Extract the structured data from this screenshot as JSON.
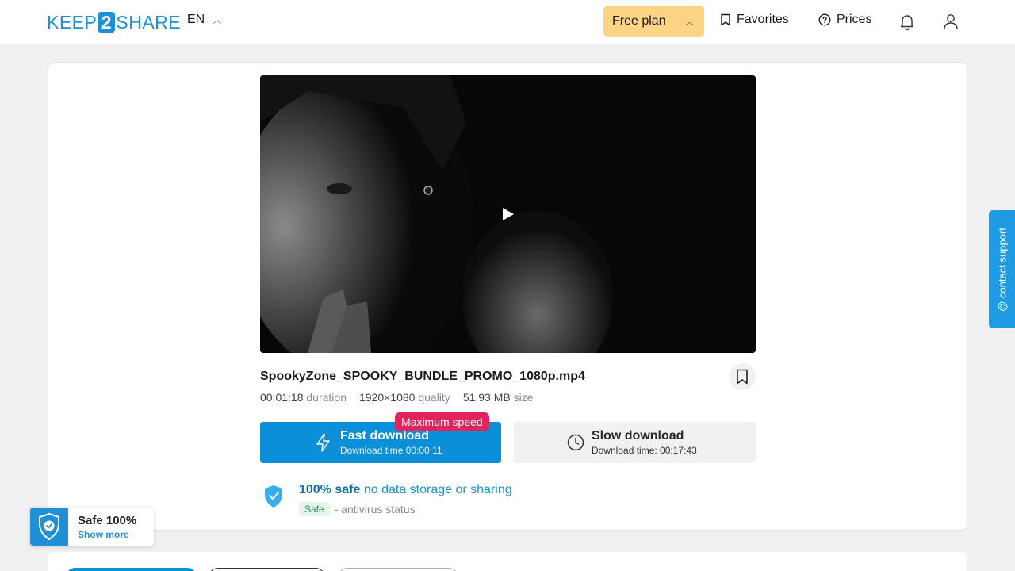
{
  "header": {
    "logo_left": "KEEP",
    "logo_mid": "2",
    "logo_right": "SHARE",
    "language": "EN",
    "plan_label": "Free plan",
    "favorites_label": "Favorites",
    "prices_label": "Prices"
  },
  "file": {
    "name": "SpookyZone_SPOOKY_BUNDLE_PROMO_1080p.mp4",
    "duration_value": "00:01:18",
    "duration_label": "duration",
    "quality_value": "1920×1080",
    "quality_label": "quality",
    "size_value": "51.93 MB",
    "size_label": "size"
  },
  "download": {
    "fast_title": "Fast download",
    "fast_time": "Download time 00:00:11",
    "badge": "Maximum speed",
    "slow_title": "Slow download",
    "slow_time": "Download time: 00:17:43"
  },
  "safety": {
    "bold": "100% safe",
    "rest": "no data storage or sharing",
    "badge": "Safe",
    "status": "- antivirus status"
  },
  "contact_label": "@ contact support",
  "safe_widget": {
    "title": "Safe 100%",
    "link": "Show more"
  },
  "colors": {
    "brand": "#1f8fd6",
    "fast_button": "#0b8fd8",
    "badge": "#e1245c",
    "plan_button": "#fdd486"
  }
}
